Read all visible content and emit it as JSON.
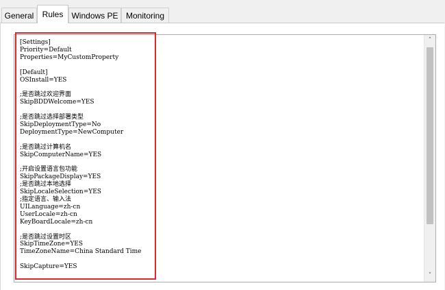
{
  "tabs": [
    {
      "label": "General"
    },
    {
      "label": "Rules"
    },
    {
      "label": "Windows PE"
    },
    {
      "label": "Monitoring"
    }
  ],
  "active_tab": "Rules",
  "editor": {
    "content": "[Settings]\nPriority=Default\nProperties=MyCustomProperty\n\n[Default]\nOSInstall=YES\n\n;是否跳过欢迎界面\nSkipBDDWelcome=YES\n\n;是否跳过选择部署类型\nSkipDeploymentType=No\nDeploymentType=NewComputer\n\n;是否跳过计算机名\nSkipComputerName=YES\n\n;开启设置语言包功能\nSkipPackageDisplay=YES\n;是否跳过本地选择\nSkipLocaleSelection=YES\n;指定语言、输入法\nUILanguage=zh-cn\nUserLocale=zh-cn\nKeyBoardLocale=zh-cn\n\n;是否跳过设置时区\nSkipTimeZone=YES\nTimeZoneName=China Standard Time\n\nSkipCapture=YES",
    "scroll_up_glyph": "˄",
    "scroll_down_glyph": "˅"
  },
  "highlight_color": "#e0252f"
}
